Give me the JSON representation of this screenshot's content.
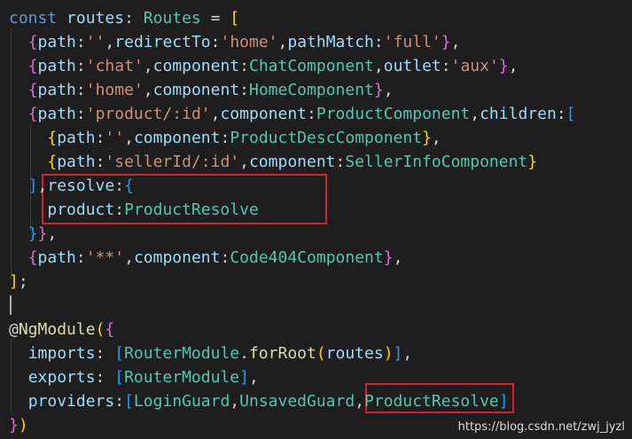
{
  "code": {
    "lines": [
      [
        [
          "kw",
          "const"
        ],
        [
          "p",
          " "
        ],
        [
          "var",
          "routes"
        ],
        [
          "p",
          ": "
        ],
        [
          "type",
          "Routes"
        ],
        [
          "p",
          " = "
        ],
        [
          "b1",
          "["
        ]
      ],
      [
        [
          "p",
          "  "
        ],
        [
          "b2",
          "{"
        ],
        [
          "var",
          "path"
        ],
        [
          "p",
          ":"
        ],
        [
          "str",
          "''"
        ],
        [
          "p",
          ","
        ],
        [
          "var",
          "redirectTo"
        ],
        [
          "p",
          ":"
        ],
        [
          "str",
          "'home'"
        ],
        [
          "p",
          ","
        ],
        [
          "var",
          "pathMatch"
        ],
        [
          "p",
          ":"
        ],
        [
          "str",
          "'full'"
        ],
        [
          "b2",
          "}"
        ],
        [
          "p",
          ","
        ]
      ],
      [
        [
          "p",
          "  "
        ],
        [
          "b2",
          "{"
        ],
        [
          "var",
          "path"
        ],
        [
          "p",
          ":"
        ],
        [
          "str",
          "'chat'"
        ],
        [
          "p",
          ","
        ],
        [
          "var",
          "component"
        ],
        [
          "p",
          ":"
        ],
        [
          "type",
          "ChatComponent"
        ],
        [
          "p",
          ","
        ],
        [
          "var",
          "outlet"
        ],
        [
          "p",
          ":"
        ],
        [
          "str",
          "'aux'"
        ],
        [
          "b2",
          "}"
        ],
        [
          "p",
          ","
        ]
      ],
      [
        [
          "p",
          "  "
        ],
        [
          "b2",
          "{"
        ],
        [
          "var",
          "path"
        ],
        [
          "p",
          ":"
        ],
        [
          "str",
          "'home'"
        ],
        [
          "p",
          ","
        ],
        [
          "var",
          "component"
        ],
        [
          "p",
          ":"
        ],
        [
          "type",
          "HomeComponent"
        ],
        [
          "b2",
          "}"
        ],
        [
          "p",
          ","
        ]
      ],
      [
        [
          "p",
          "  "
        ],
        [
          "b2",
          "{"
        ],
        [
          "var",
          "path"
        ],
        [
          "p",
          ":"
        ],
        [
          "str",
          "'product/:id'"
        ],
        [
          "p",
          ","
        ],
        [
          "var",
          "component"
        ],
        [
          "p",
          ":"
        ],
        [
          "type",
          "ProductComponent"
        ],
        [
          "p",
          ","
        ],
        [
          "var",
          "children"
        ],
        [
          "p",
          ":"
        ],
        [
          "b3",
          "["
        ]
      ],
      [
        [
          "p",
          "    "
        ],
        [
          "b1",
          "{"
        ],
        [
          "var",
          "path"
        ],
        [
          "p",
          ":"
        ],
        [
          "str",
          "''"
        ],
        [
          "p",
          ","
        ],
        [
          "var",
          "component"
        ],
        [
          "p",
          ":"
        ],
        [
          "type",
          "ProductDescComponent"
        ],
        [
          "b1",
          "}"
        ],
        [
          "p",
          ","
        ]
      ],
      [
        [
          "p",
          "    "
        ],
        [
          "b1",
          "{"
        ],
        [
          "var",
          "path"
        ],
        [
          "p",
          ":"
        ],
        [
          "str",
          "'sellerId/:id'"
        ],
        [
          "p",
          ","
        ],
        [
          "var",
          "component"
        ],
        [
          "p",
          ":"
        ],
        [
          "type",
          "SellerInfoComponent"
        ],
        [
          "b1",
          "}"
        ]
      ],
      [
        [
          "p",
          "  "
        ],
        [
          "b3",
          "]"
        ],
        [
          "p",
          ","
        ],
        [
          "var",
          "resolve"
        ],
        [
          "p",
          ":"
        ],
        [
          "b3",
          "{"
        ]
      ],
      [
        [
          "p",
          "    "
        ],
        [
          "var",
          "product"
        ],
        [
          "p",
          ":"
        ],
        [
          "type",
          "ProductResolve"
        ]
      ],
      [
        [
          "p",
          "  "
        ],
        [
          "b3",
          "}"
        ],
        [
          "b2",
          "}"
        ],
        [
          "p",
          ","
        ]
      ],
      [
        [
          "p",
          "  "
        ],
        [
          "b2",
          "{"
        ],
        [
          "var",
          "path"
        ],
        [
          "p",
          ":"
        ],
        [
          "str",
          "'**'"
        ],
        [
          "p",
          ","
        ],
        [
          "var",
          "component"
        ],
        [
          "p",
          ":"
        ],
        [
          "type",
          "Code404Component"
        ],
        [
          "b2",
          "}"
        ],
        [
          "p",
          ","
        ]
      ],
      [
        [
          "b1",
          "]"
        ],
        [
          "p",
          ";"
        ]
      ],
      [],
      [
        [
          "p",
          "@"
        ],
        [
          "fn",
          "NgModule"
        ],
        [
          "b1",
          "("
        ],
        [
          "b2",
          "{"
        ]
      ],
      [
        [
          "p",
          "  "
        ],
        [
          "var",
          "imports"
        ],
        [
          "p",
          ": "
        ],
        [
          "b3",
          "["
        ],
        [
          "type",
          "RouterModule"
        ],
        [
          "p",
          "."
        ],
        [
          "fn",
          "forRoot"
        ],
        [
          "b1",
          "("
        ],
        [
          "var",
          "routes"
        ],
        [
          "b1",
          ")"
        ],
        [
          "b3",
          "]"
        ],
        [
          "p",
          ","
        ]
      ],
      [
        [
          "p",
          "  "
        ],
        [
          "var",
          "exports"
        ],
        [
          "p",
          ": "
        ],
        [
          "b3",
          "["
        ],
        [
          "type",
          "RouterModule"
        ],
        [
          "b3",
          "]"
        ],
        [
          "p",
          ","
        ]
      ],
      [
        [
          "p",
          "  "
        ],
        [
          "var",
          "providers"
        ],
        [
          "p",
          ":"
        ],
        [
          "b3",
          "["
        ],
        [
          "type",
          "LoginGuard"
        ],
        [
          "p",
          ","
        ],
        [
          "type",
          "UnsavedGuard"
        ],
        [
          "p",
          ","
        ],
        [
          "type",
          "ProductResolve"
        ],
        [
          "b3",
          "]"
        ]
      ],
      [
        [
          "b2",
          "}"
        ],
        [
          "b1",
          ")"
        ]
      ]
    ]
  },
  "colors": {
    "kw": "#569cd6",
    "var": "#9cdcfe",
    "type": "#4ec9b0",
    "str": "#ce9178",
    "fn": "#dcdcaa",
    "p": "#d4d4d4",
    "b1": "#ffd700",
    "b2": "#da70d6",
    "b3": "#179fff",
    "highlight_box": "#d0232a",
    "background": "#1e1e1e"
  },
  "watermark": "https://blog.csdn.net/zwj_jyzl"
}
